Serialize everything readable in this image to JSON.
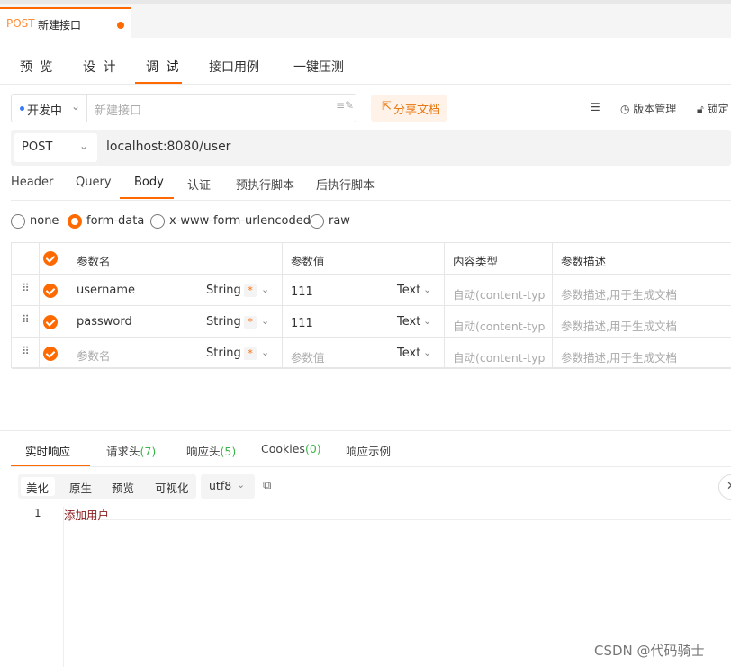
{
  "top_tab": {
    "method": "POST",
    "name": "新建接口"
  },
  "main_tabs": [
    "预 览",
    "设 计",
    "调 试",
    "接口用例",
    "一键压测"
  ],
  "env": {
    "selected": "开发中",
    "name_placeholder": "新建接口"
  },
  "share_button": "分享文档",
  "right_tools": {
    "version": "版本管理",
    "lock": "锁定"
  },
  "request": {
    "method": "POST",
    "url": "localhost:8080/user"
  },
  "body_tabs": [
    "Header",
    "Query",
    "Body",
    "认证",
    "预执行脚本",
    "后执行脚本"
  ],
  "body_types": [
    "none",
    "form-data",
    "x-www-form-urlencoded",
    "raw"
  ],
  "table": {
    "headers": [
      "参数名",
      "参数值",
      "内容类型",
      "参数描述"
    ],
    "rows": [
      {
        "name": "username",
        "type": "String",
        "required": "*",
        "value": "111",
        "field_type": "Text",
        "content_type": "自动(content-typ",
        "desc": "参数描述,用于生成文档"
      },
      {
        "name": "password",
        "type": "String",
        "required": "*",
        "value": "111",
        "field_type": "Text",
        "content_type": "自动(content-typ",
        "desc": "参数描述,用于生成文档"
      },
      {
        "name": "参数名",
        "type": "String",
        "required": "*",
        "value": "参数值",
        "field_type": "Text",
        "content_type": "自动(content-typ",
        "desc": "参数描述,用于生成文档"
      }
    ]
  },
  "response_tabs": {
    "realtime": "实时响应",
    "req_headers": "请求头",
    "req_headers_count": "(7)",
    "res_headers": "响应头",
    "res_headers_count": "(5)",
    "cookies": "Cookies",
    "cookies_count": "(0)",
    "example": "响应示例"
  },
  "view_modes": [
    "美化",
    "原生",
    "预览",
    "可视化"
  ],
  "encoding": "utf8",
  "editor": {
    "line_number": "1",
    "content": "添加用户"
  },
  "watermark": "CSDN @代码骑士"
}
